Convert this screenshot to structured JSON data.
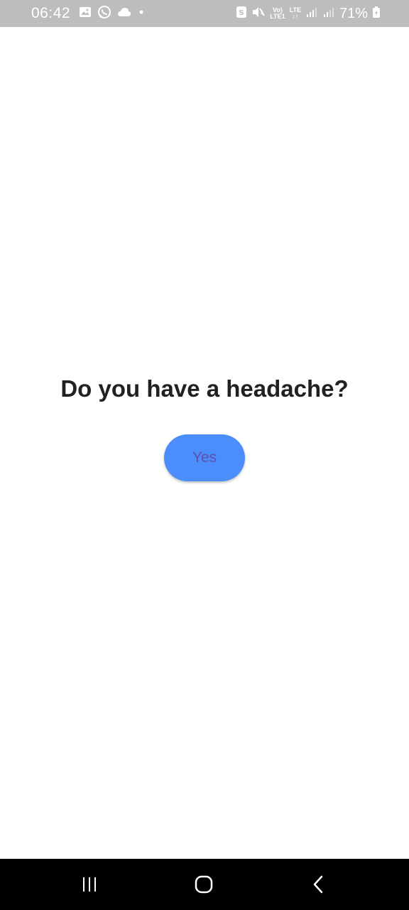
{
  "status_bar": {
    "time": "06:42",
    "battery_percent": "71%",
    "network_top": "Vo)",
    "network_bottom": "LTE1",
    "lte_label": "LTE",
    "icons_left": [
      "gallery-icon",
      "whatsapp-icon",
      "cloud-icon",
      "dot-icon"
    ],
    "icons_right": [
      "save-icon",
      "mute-icon",
      "volte-icon",
      "lte-icon",
      "signal-icon",
      "signal-icon",
      "battery-icon"
    ]
  },
  "main": {
    "question": "Do you have a headache?",
    "yes_label": "Yes"
  },
  "nav_bar": {
    "icons": [
      "recents-icon",
      "home-icon",
      "back-icon"
    ]
  },
  "colors": {
    "status_bar_bg": "#bdbdbd",
    "button_bg": "#4a8dfb",
    "button_text": "#5e4fb0",
    "question_text": "#202124",
    "nav_bar_bg": "#000000"
  }
}
